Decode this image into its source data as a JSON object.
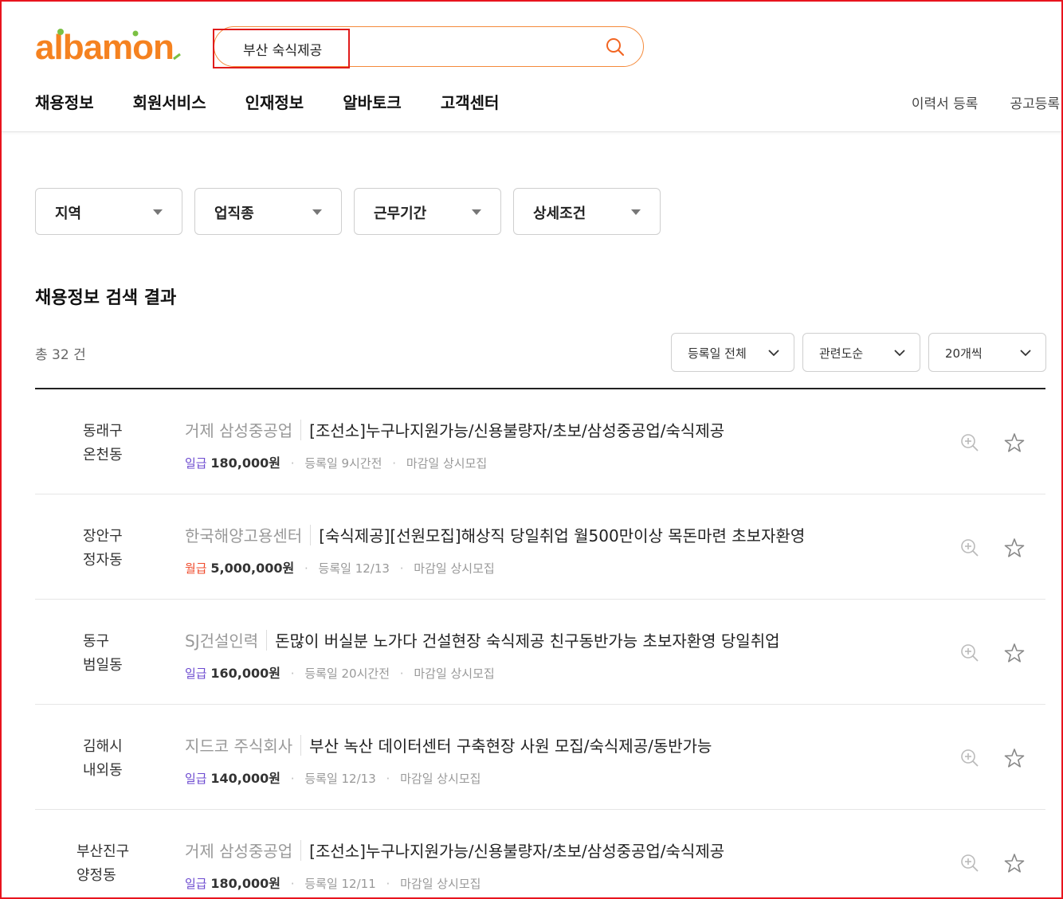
{
  "brand": {
    "logo_text": "albamon",
    "accent": "#f58220"
  },
  "search": {
    "value": "부산 숙식제공"
  },
  "nav": {
    "items": [
      "채용정보",
      "회원서비스",
      "인재정보",
      "알바토크",
      "고객센터"
    ]
  },
  "util": {
    "items": [
      "이력서 등록",
      "공고등록"
    ]
  },
  "filters": [
    "지역",
    "업직종",
    "근무기간",
    "상세조건"
  ],
  "results": {
    "title": "채용정보 검색 결과",
    "total": "총 32 건",
    "sorts": [
      "등록일 전체",
      "관련도순",
      "20개씩"
    ]
  },
  "jobs": [
    {
      "loc1": "동래구",
      "loc2": "온천동",
      "company": "거제 삼성중공업",
      "title": "[조선소]누구나지원가능/신용불량자/초보/삼성중공업/숙식제공",
      "pay_type": "일급",
      "pay_kind": "daily",
      "amount": "180,000원",
      "registered": "등록일 9시간전",
      "deadline": "마감일 상시모집"
    },
    {
      "loc1": "장안구",
      "loc2": "정자동",
      "company": "한국해양고용센터",
      "title": "[숙식제공][선원모집]해상직 당일취업 월500만이상 목돈마련 초보자환영",
      "pay_type": "월급",
      "pay_kind": "monthly",
      "amount": "5,000,000원",
      "registered": "등록일 12/13",
      "deadline": "마감일 상시모집"
    },
    {
      "loc1": "동구",
      "loc2": "범일동",
      "company": "SJ건설인력",
      "title": "돈많이 버실분 노가다 건설현장 숙식제공 친구동반가능 초보자환영 당일취업",
      "pay_type": "일급",
      "pay_kind": "daily",
      "amount": "160,000원",
      "registered": "등록일 20시간전",
      "deadline": "마감일 상시모집"
    },
    {
      "loc1": "김해시",
      "loc2": "내외동",
      "company": "지드코 주식회사",
      "title": "부산 녹산 데이터센터 구축현장 사원 모집/숙식제공/동반가능",
      "pay_type": "일급",
      "pay_kind": "daily",
      "amount": "140,000원",
      "registered": "등록일 12/13",
      "deadline": "마감일 상시모집"
    },
    {
      "loc1": "부산진구",
      "loc2": "양정동",
      "company": "거제 삼성중공업",
      "title": "[조선소]누구나지원가능/신용불량자/초보/삼성중공업/숙식제공",
      "pay_type": "일급",
      "pay_kind": "daily",
      "amount": "180,000원",
      "registered": "등록일 12/11",
      "deadline": "마감일 상시모집"
    }
  ]
}
